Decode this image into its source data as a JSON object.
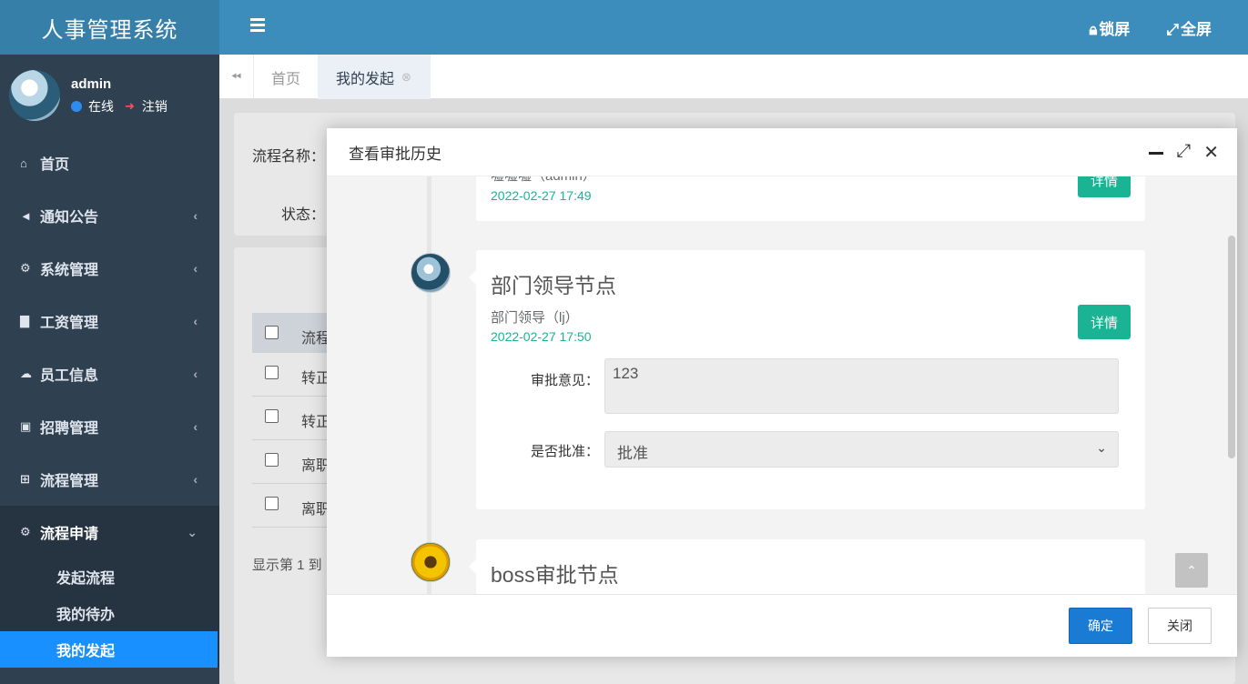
{
  "sidebar": {
    "brand": "人事管理系统",
    "user": {
      "name": "admin",
      "status": "在线",
      "logout": "注销"
    },
    "menu": [
      {
        "label": "首页",
        "icon": "home-icon"
      },
      {
        "label": "通知公告",
        "icon": "bullhorn-icon"
      },
      {
        "label": "系统管理",
        "icon": "gear-icon"
      },
      {
        "label": "工资管理",
        "icon": "bar-chart-icon"
      },
      {
        "label": "员工信息",
        "icon": "cloud-icon"
      },
      {
        "label": "招聘管理",
        "icon": "id-card-icon"
      },
      {
        "label": "流程管理",
        "icon": "sitemap-icon"
      },
      {
        "label": "流程申请",
        "icon": "gears-icon"
      }
    ],
    "submenu": [
      "发起流程",
      "我的待办",
      "我的发起"
    ]
  },
  "topbar": {
    "lock": "锁屏",
    "fullscreen": "全屏"
  },
  "tabs": [
    {
      "label": "首页"
    },
    {
      "label": "我的发起"
    }
  ],
  "search": {
    "process_name_label": "流程名称：",
    "status_label": "状态："
  },
  "table": {
    "header": "流程",
    "rows": [
      "转正",
      "转正",
      "离职",
      "离职"
    ],
    "footer": "显示第 1 到"
  },
  "modal": {
    "title": "查看审批历史",
    "prev_entry": {
      "who": "嘘嘘嘘（admin）",
      "time": "2022-02-27 17:49",
      "detail": "详情"
    },
    "entry1": {
      "title": "部门领导节点",
      "who": "部门领导（lj）",
      "time": "2022-02-27 17:50",
      "detail": "详情",
      "opinion_label": "审批意见：",
      "opinion_value": "123",
      "approve_label": "是否批准：",
      "approve_value": "批准"
    },
    "entry2": {
      "title": "boss审批节点"
    },
    "ok": "确定",
    "close": "关闭"
  }
}
